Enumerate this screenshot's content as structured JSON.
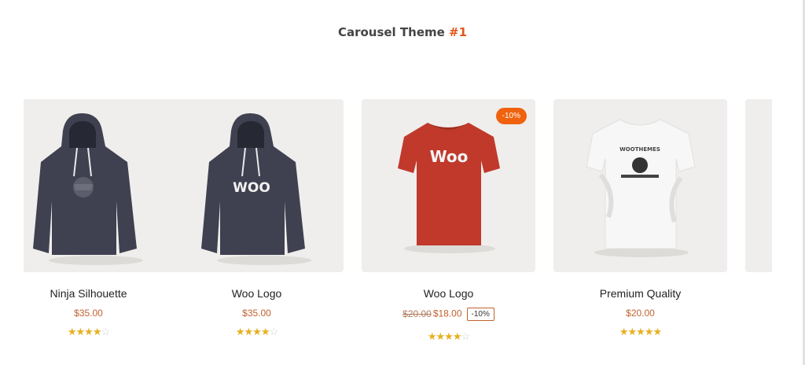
{
  "heading": {
    "text": "Carousel Theme ",
    "accent": "#1"
  },
  "products": [
    {
      "name": "Ninja Silhouette",
      "price": "$35.00",
      "rating_fraction": 0.8
    },
    {
      "name": "Woo Logo",
      "price": "$35.00",
      "rating_fraction": 0.8,
      "logo_text": "WOO"
    },
    {
      "name": "Woo Logo",
      "old_price": "$20.00",
      "price": "$18.00",
      "discount": "-10%",
      "badge": "-10%",
      "rating_fraction": 0.8,
      "logo_text": "Woo"
    },
    {
      "name": "Premium Quality",
      "price": "$20.00",
      "rating_fraction": 0.9,
      "logo_text": "WOOTHEMES"
    }
  ],
  "colors": {
    "accent": "#e4561a",
    "badge": "#f0620e",
    "price": "#c2622f",
    "star": "#e6b020",
    "card_bg": "#efeeec"
  },
  "icons": [
    "hoodie-icon",
    "tshirt-icon",
    "star-icon"
  ]
}
